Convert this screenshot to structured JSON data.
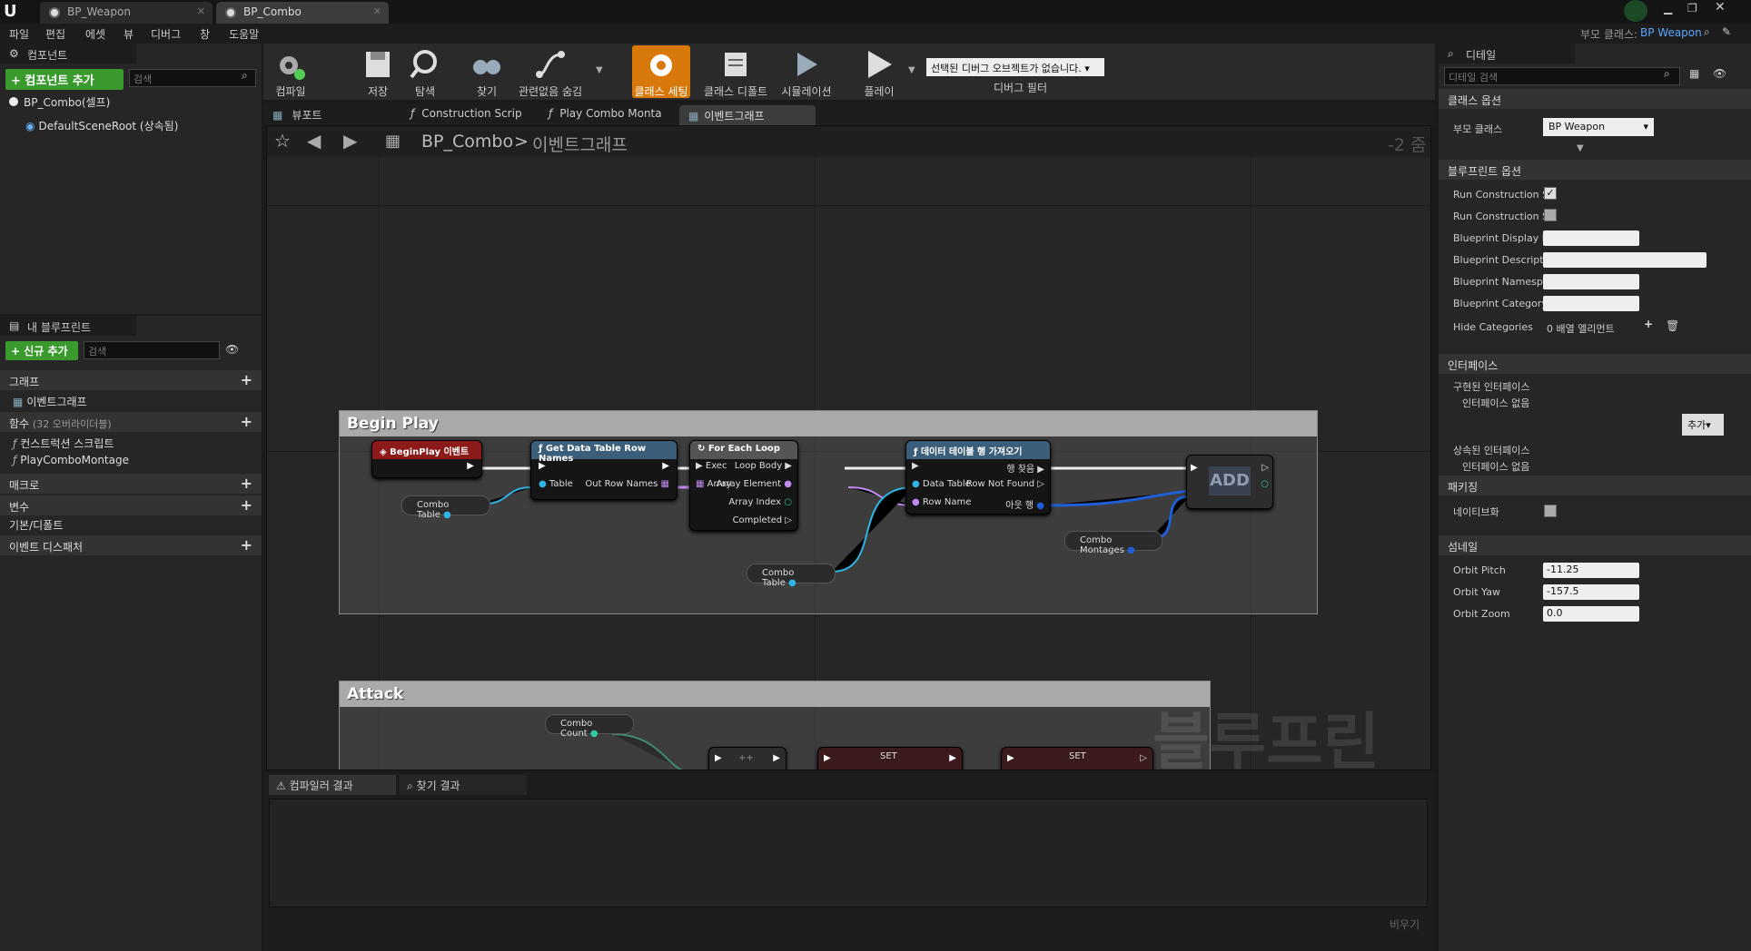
{
  "window": {
    "tab1": "BP_Weapon",
    "tab2": "BP_Combo",
    "parent_label": "부모 클래스:",
    "parent_value": "BP Weapon"
  },
  "menu": [
    "파일",
    "편집",
    "에셋",
    "뷰",
    "디버그",
    "창",
    "도움말"
  ],
  "components": {
    "tab": "컴포넌트",
    "add_button": "+ 컴포넌트 추가",
    "search_placeholder": "검색",
    "self": "BP_Combo(셀프)",
    "root": "DefaultSceneRoot (상속됨)"
  },
  "myblueprint": {
    "tab": "내 블루프린트",
    "new_button": "+ 신규 추가",
    "search_placeholder": "검색",
    "graph_section": "그래프",
    "eventgraph": "이벤트그래프",
    "functions_section": "함수",
    "functions_note": "(32 오버라이더블)",
    "func1": "컨스트럭션 스크립트",
    "func2": "PlayComboMontage",
    "macros": "매크로",
    "variables": "변수",
    "components_cat": "기본/디폴트",
    "dispatchers": "이벤트 디스패처"
  },
  "toolbar": {
    "compile": "컴파일",
    "save": "저장",
    "browse": "탐색",
    "find": "찾기",
    "hide_unrelated": "관련없음 숨김",
    "class_settings": "클래스 세팅",
    "class_defaults": "클래스 디폴트",
    "simulation": "시뮬레이션",
    "play": "플레이",
    "debug_select": "선택된 디버그 오브젝트가 없습니다.",
    "debug_filter": "디버그 필터"
  },
  "doc_tabs": [
    "뷰포트",
    "Construction Scrip",
    "Play Combo Monta",
    "이벤트그래프"
  ],
  "breadcrumb": {
    "root": "BP_Combo",
    "sep": ">",
    "current": "이벤트그래프",
    "zoom": "-2 줌"
  },
  "graph": {
    "comment1": "Begin Play",
    "comment2": "Attack",
    "watermark": "블루프린트",
    "begin_play": "BeginPlay 이벤트",
    "get_rows": "Get Data Table Row Names",
    "table": "Table",
    "out_row_names": "Out Row Names",
    "foreach": "For Each Loop",
    "exec": "Exec",
    "loop_body": "Loop Body",
    "array": "Array",
    "array_element": "Array Element",
    "array_index": "Array Index",
    "completed": "Completed",
    "get_row": "데이터 테이블 행 가져오기",
    "row_found": "행 찾음",
    "data_table": "Data Table",
    "row_not_found": "Row Not Found",
    "row_name": "Row Name",
    "out_row": "아웃 행",
    "add": "ADD",
    "combo_table": "Combo Table",
    "combo_montages": "Combo Montages",
    "combo_count": "Combo Count",
    "set": "SET"
  },
  "output": {
    "tab1": "컴파일러 결과",
    "tab2": "찾기 결과",
    "clear": "비우기"
  },
  "details": {
    "tab": "디테일",
    "search_placeholder": "디테일 검색",
    "class_options": "클래스 옵션",
    "parent_class": "부모 클래스",
    "parent_value": "BP Weapon",
    "bp_options": "블루프린트 옵션",
    "run_cs1": "Run Construction S",
    "run_cs2": "Run Construction S",
    "bp_display": "Blueprint Display N",
    "bp_desc": "Blueprint Descriptio",
    "bp_ns": "Blueprint Namespa",
    "bp_cat": "Blueprint Category",
    "hide_cat": "Hide Categories",
    "hide_cat_val": "0 배열 엘리먼트",
    "interfaces": "인터페이스",
    "impl": "구현된 인터페이스",
    "impl_none": "인터페이스 없음",
    "add": "추가",
    "inherited": "상속된 인터페이스",
    "inherited_none": "인터페이스 없음",
    "packaging": "패키징",
    "nativize": "네이티브화",
    "thumbnail": "섬네일",
    "orbit_pitch": "Orbit Pitch",
    "orbit_pitch_val": "-11.25",
    "orbit_yaw": "Orbit Yaw",
    "orbit_yaw_val": "-157.5",
    "orbit_zoom": "Orbit Zoom",
    "orbit_zoom_val": "0.0"
  }
}
